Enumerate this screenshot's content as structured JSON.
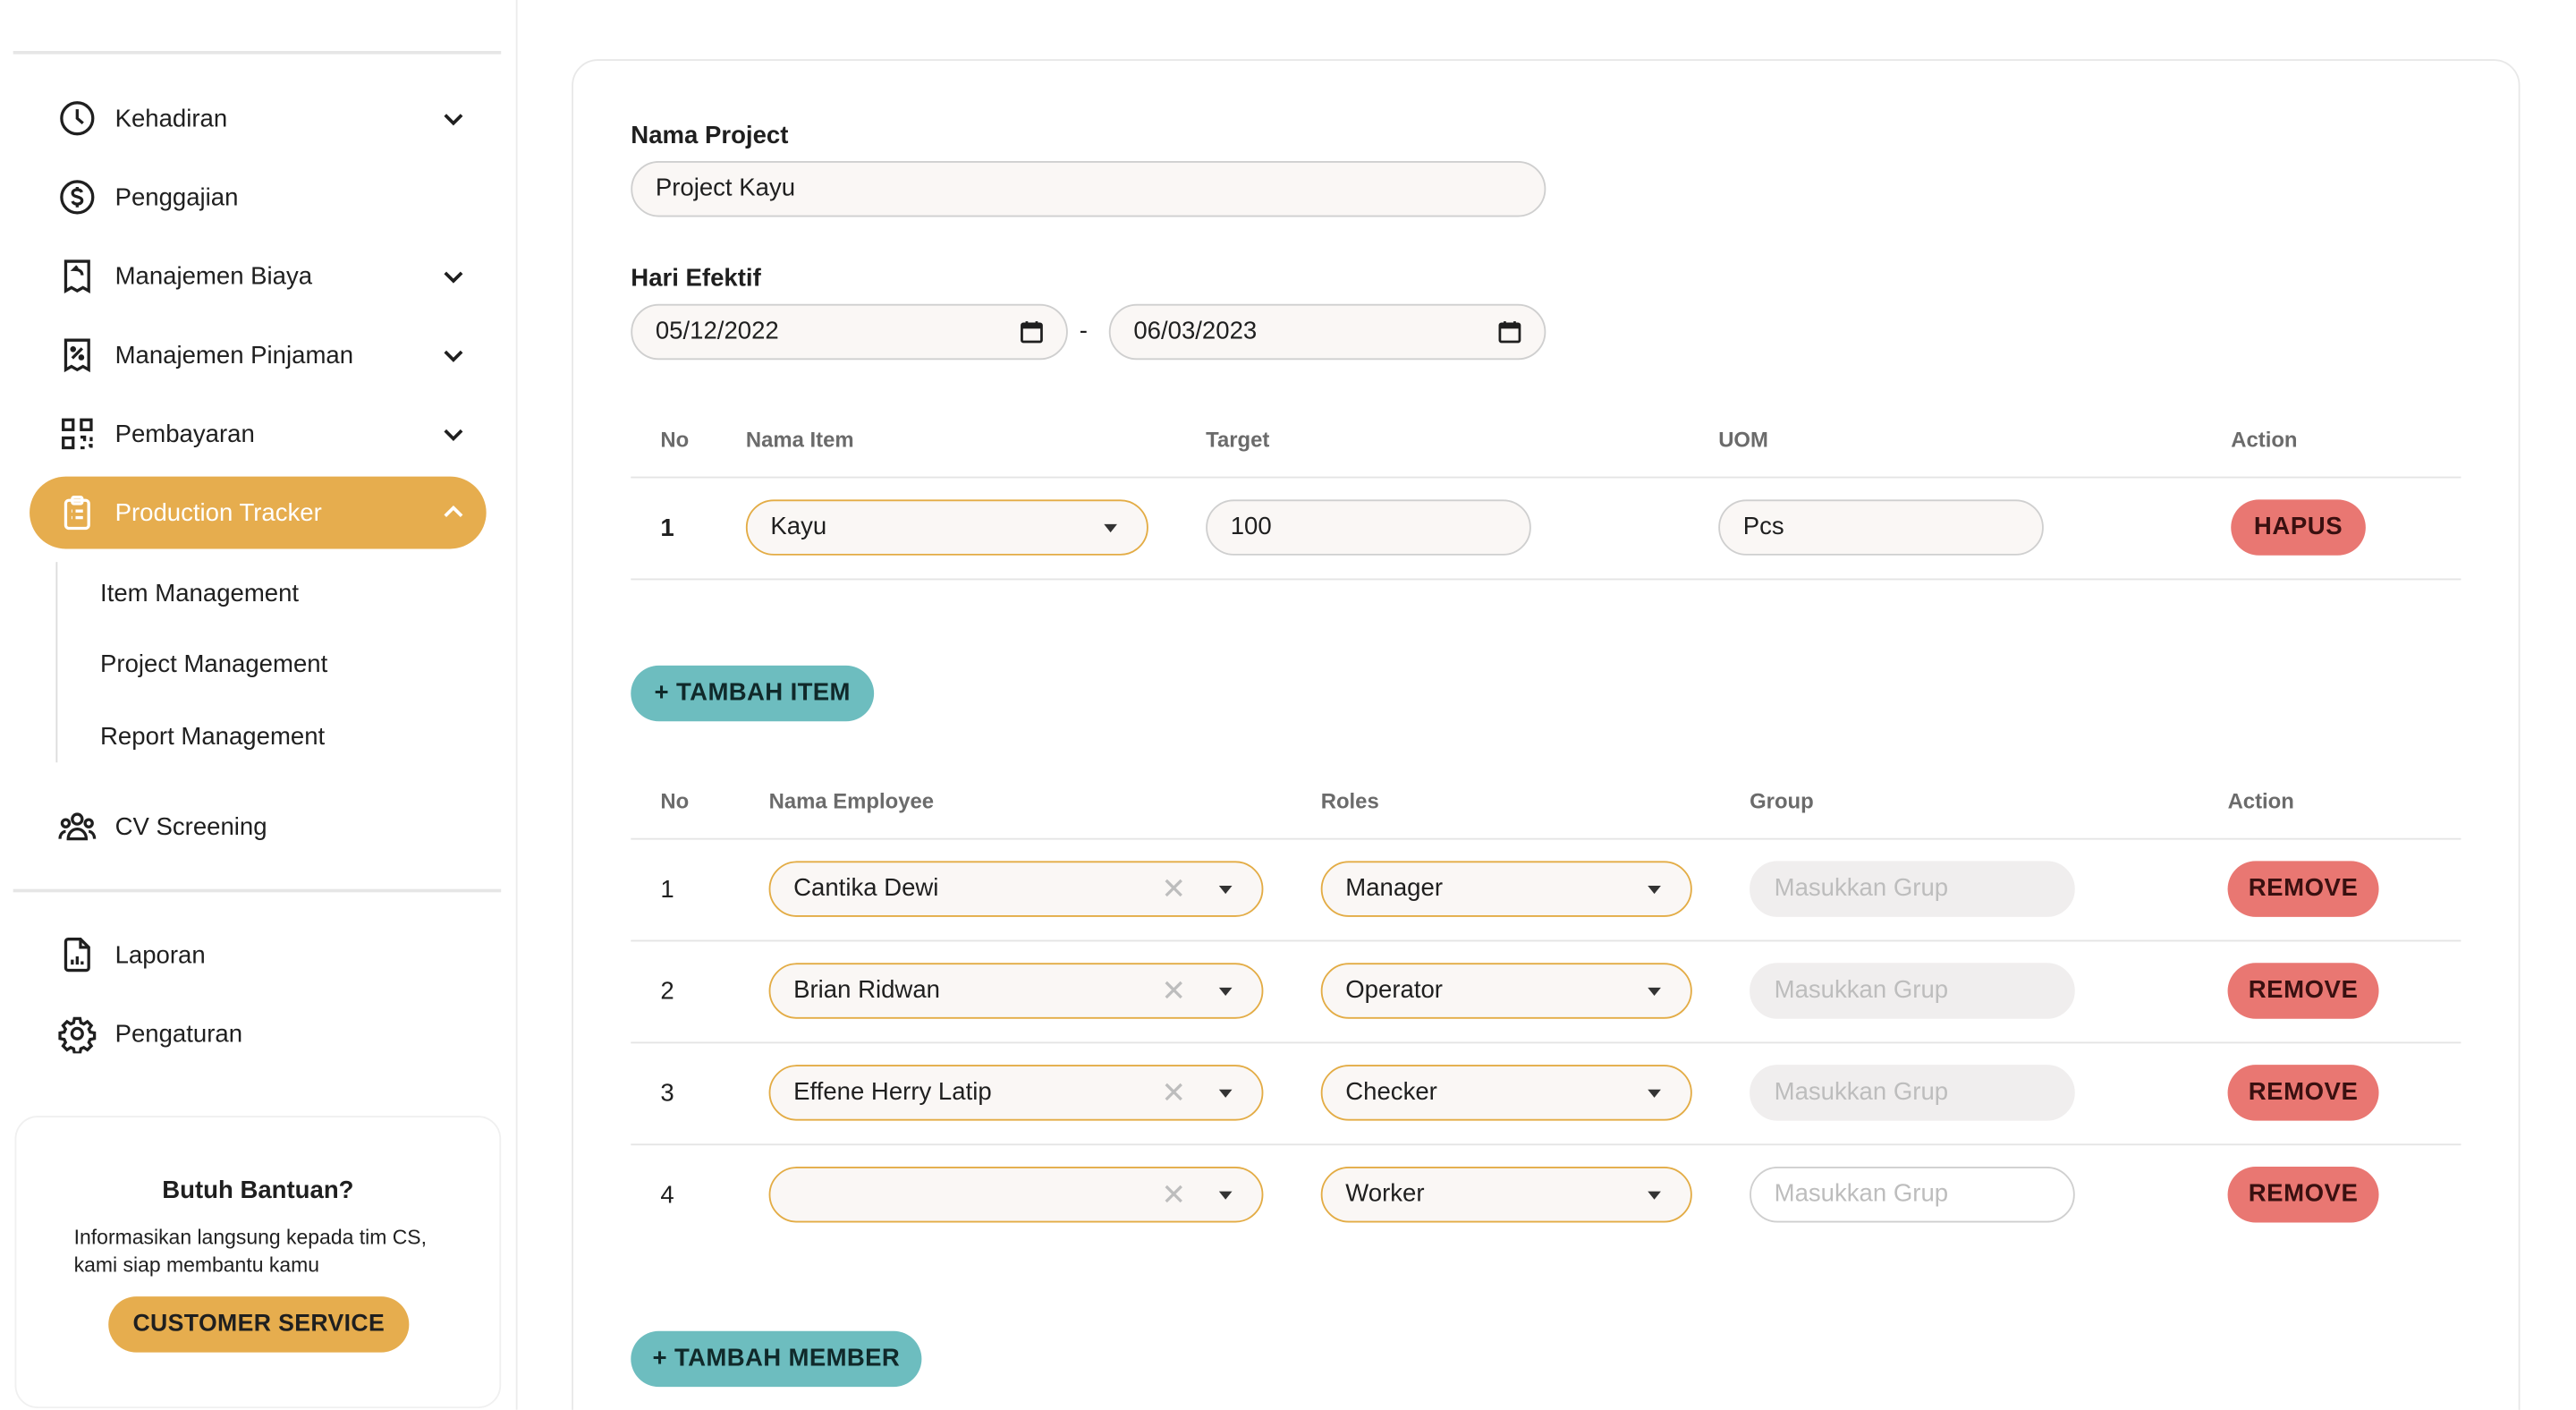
{
  "sidebar": {
    "items": [
      {
        "label": "Kehadiran",
        "icon": "clock-icon",
        "has_chevron": true
      },
      {
        "label": "Penggajian",
        "icon": "dollar-circle-icon",
        "has_chevron": false
      },
      {
        "label": "Manajemen Biaya",
        "icon": "receipt-refund-icon",
        "has_chevron": true
      },
      {
        "label": "Manajemen Pinjaman",
        "icon": "receipt-percent-icon",
        "has_chevron": true
      },
      {
        "label": "Pembayaran",
        "icon": "qr-code-icon",
        "has_chevron": true
      },
      {
        "label": "Production Tracker",
        "icon": "clipboard-icon",
        "has_chevron": true,
        "active": true
      },
      {
        "label": "CV Screening",
        "icon": "users-icon",
        "has_chevron": false
      },
      {
        "label": "Laporan",
        "icon": "document-chart-icon",
        "has_chevron": false
      },
      {
        "label": "Pengaturan",
        "icon": "gear-icon",
        "has_chevron": false
      }
    ],
    "subitems": [
      "Item Management",
      "Project Management",
      "Report Management"
    ],
    "help": {
      "title": "Butuh Bantuan?",
      "description": "Informasikan langsung kepada tim CS, kami siap membantu kamu",
      "button": "CUSTOMER SERVICE"
    }
  },
  "form": {
    "project_name_label": "Nama Project",
    "project_name_value": "Project Kayu",
    "effective_days_label": "Hari Efektif",
    "start_date": "05/12/2022",
    "date_separator": "-",
    "end_date": "06/03/2023"
  },
  "items_table": {
    "headers": [
      "No",
      "Nama Item",
      "Target",
      "UOM",
      "Action"
    ],
    "rows": [
      {
        "no": "1",
        "item": "Kayu",
        "target": "100",
        "uom": "Pcs",
        "action": "HAPUS"
      }
    ],
    "add_button": "+ TAMBAH ITEM"
  },
  "members_table": {
    "headers": [
      "No",
      "Nama Employee",
      "Roles",
      "Group",
      "Action"
    ],
    "group_placeholder": "Masukkan Grup",
    "rows": [
      {
        "no": "1",
        "employee": "Cantika Dewi",
        "role": "Manager",
        "action": "REMOVE"
      },
      {
        "no": "2",
        "employee": "Brian Ridwan",
        "role": "Operator",
        "action": "REMOVE"
      },
      {
        "no": "3",
        "employee": "Effene Herry Latip",
        "role": "Checker",
        "action": "REMOVE"
      },
      {
        "no": "4",
        "employee": "",
        "role": "Worker",
        "action": "REMOVE"
      }
    ],
    "add_button": "+ TAMBAH MEMBER"
  },
  "colors": {
    "accent": "#e6ad4e",
    "danger": "#e97772",
    "teal": "#6dbdbf"
  }
}
